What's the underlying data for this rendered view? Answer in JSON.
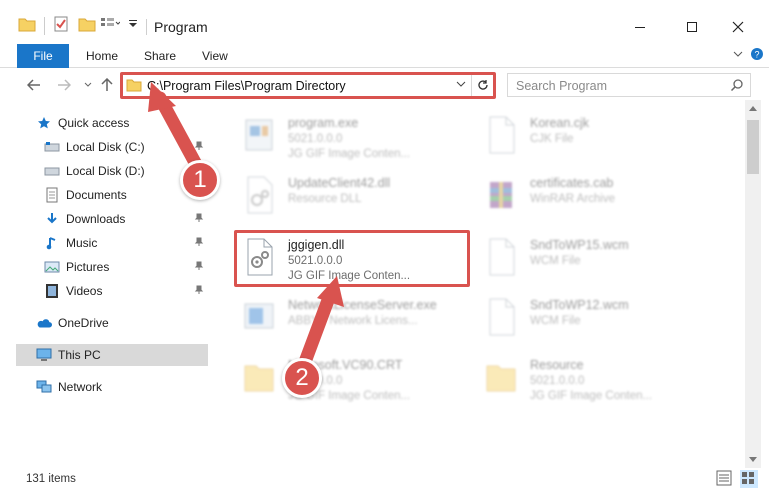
{
  "window": {
    "title": "Program"
  },
  "ribbon": {
    "tabs": [
      "File",
      "Home",
      "Share",
      "View"
    ]
  },
  "address": {
    "path": "C:\\Program Files\\Program Directory"
  },
  "search": {
    "placeholder": "Search Program"
  },
  "nav": {
    "items": [
      {
        "label": "Quick access",
        "icon": "star-icon"
      },
      {
        "label": "Local Disk (C:)",
        "icon": "drive-icon"
      },
      {
        "label": "Local Disk (D:)",
        "icon": "drive-icon"
      },
      {
        "label": "Documents",
        "icon": "documents-icon"
      },
      {
        "label": "Downloads",
        "icon": "download-icon"
      },
      {
        "label": "Music",
        "icon": "music-icon"
      },
      {
        "label": "Pictures",
        "icon": "pictures-icon"
      },
      {
        "label": "Videos",
        "icon": "videos-icon"
      },
      {
        "label": "OneDrive",
        "icon": "cloud-icon"
      },
      {
        "label": "This PC",
        "icon": "computer-icon"
      },
      {
        "label": "Network",
        "icon": "network-icon"
      }
    ]
  },
  "files": [
    {
      "name": "program.exe",
      "line2": "5021.0.0.0",
      "line3": "JG GIF Image Conten..."
    },
    {
      "name": "Korean.cjk",
      "line2": "CJK File",
      "line3": ""
    },
    {
      "name": "UpdateClient42.dll",
      "line2": "Resource DLL",
      "line3": ""
    },
    {
      "name": "certificates.cab",
      "line2": "WinRAR Archive",
      "line3": ""
    },
    {
      "name": "jggigen.dll",
      "line2": "5021.0.0.0",
      "line3": "JG GIF Image Conten..."
    },
    {
      "name": "SndToWP15.wcm",
      "line2": "WCM File",
      "line3": ""
    },
    {
      "name": "NetworkLicenseServer.exe",
      "line2": "ABBYY Network Licens...",
      "line3": ""
    },
    {
      "name": "SndToWP12.wcm",
      "line2": "WCM File",
      "line3": ""
    },
    {
      "name": "Microsoft.VC90.CRT",
      "line2": "5021.0.0.0",
      "line3": "JG GIF Image Conten..."
    },
    {
      "name": "Resource",
      "line2": "5021.0.0.0",
      "line3": "JG GIF Image Conten..."
    }
  ],
  "status": {
    "count": "131 items"
  },
  "annotations": {
    "step1": "1",
    "step2": "2"
  },
  "colors": {
    "accent": "#1a76c9",
    "highlight": "#d9534f"
  }
}
